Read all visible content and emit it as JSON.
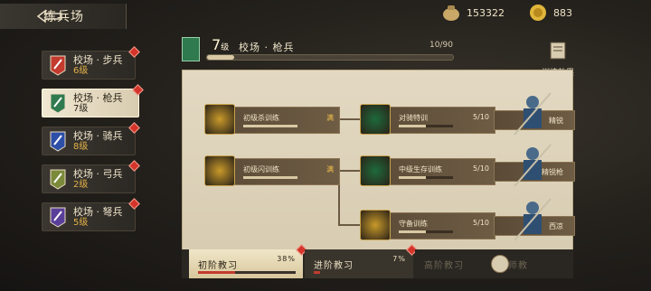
{
  "header": {
    "title": "练兵场"
  },
  "resources": [
    {
      "name": "copper",
      "icon": "coin-bag-icon",
      "value": "153322"
    },
    {
      "name": "gold",
      "icon": "gold-ingot-icon",
      "value": "883"
    }
  ],
  "units": [
    {
      "name": "校场 · 步兵",
      "level": "6级",
      "icon": "infantry-icon",
      "color": "#c23b2e",
      "selected": false
    },
    {
      "name": "校场 · 枪兵",
      "level": "7级",
      "icon": "spearman-icon",
      "color": "#2f7a4e",
      "selected": true
    },
    {
      "name": "校场 · 骑兵",
      "level": "8级",
      "icon": "cavalry-icon",
      "color": "#2e4fa8",
      "selected": false
    },
    {
      "name": "校场 · 弓兵",
      "level": "2级",
      "icon": "archer-icon",
      "color": "#7a8a3a",
      "selected": false
    },
    {
      "name": "校场 · 弩兵",
      "level": "5级",
      "icon": "crossbow-icon",
      "color": "#5a3f9a",
      "selected": false
    }
  ],
  "training": {
    "level_num": "7",
    "level_unit": "级",
    "name": "校场 · 枪兵",
    "progress_text": "10/90",
    "progress": 0.11,
    "effect_label": "训练效果"
  },
  "nodes": [
    {
      "label": "初级杀训练",
      "value": "满",
      "done": true,
      "fill": 1.0,
      "icon": "crossed-swords-icon"
    },
    {
      "label": "对骑特训",
      "value": "5/10",
      "done": false,
      "fill": 0.5,
      "icon": "green-slash-icon"
    },
    {
      "label": "初级闪训练",
      "value": "满",
      "done": true,
      "fill": 1.0,
      "icon": "armor-icon"
    },
    {
      "label": "中级生存训练",
      "value": "5/10",
      "done": false,
      "fill": 0.5,
      "icon": "green-swirl-icon"
    },
    {
      "label": "守备训练",
      "value": "5/10",
      "done": false,
      "fill": 0.5,
      "icon": "armor-gold-icon"
    }
  ],
  "rewards": [
    {
      "label": "精锐"
    },
    {
      "label": "精锐枪"
    },
    {
      "label": "西凉"
    }
  ],
  "tabs": [
    {
      "name": "初阶教习",
      "pct": "38%",
      "fill": 0.38,
      "active": true
    },
    {
      "name": "进阶教习",
      "pct": "7%",
      "fill": 0.07,
      "active": false
    },
    {
      "name": "高阶教习",
      "pct": "",
      "fill": 0,
      "active": false
    },
    {
      "name": "宗师教",
      "pct": "",
      "fill": 0,
      "active": false
    }
  ]
}
